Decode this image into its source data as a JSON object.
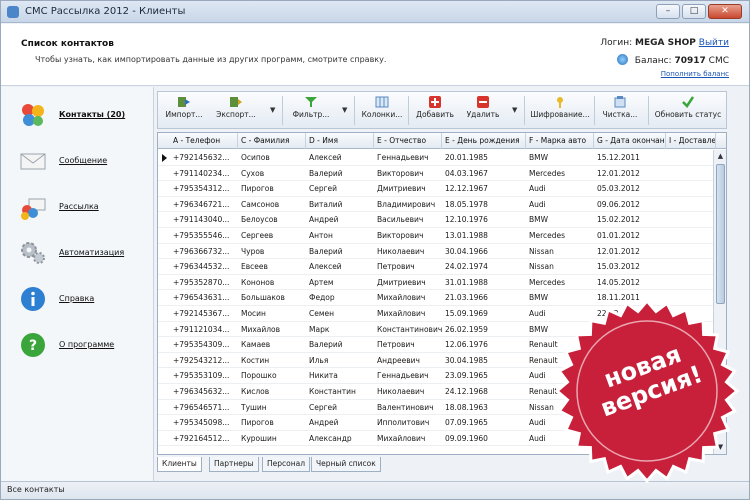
{
  "window": {
    "title": "СМС Рассылка 2012 - Клиенты"
  },
  "header": {
    "title": "Список контактов",
    "subtitle": "Чтобы узнать, как импортировать данные из других программ, смотрите справку.",
    "login_label": "Логин:",
    "login_value": "MEGA SHOP",
    "logout_link": "Выйти",
    "balance_label": "Баланс:",
    "balance_value": "70917",
    "balance_unit": "СМС",
    "topup_link": "Пополнить баланс"
  },
  "sidebar": {
    "items": [
      {
        "label": "Контакты (20)",
        "icon": "contacts-icon"
      },
      {
        "label": "Сообщение",
        "icon": "envelope-icon"
      },
      {
        "label": "Рассылка",
        "icon": "mailing-icon"
      },
      {
        "label": "Автоматизация",
        "icon": "gears-icon"
      },
      {
        "label": "Справка",
        "icon": "info-icon"
      },
      {
        "label": "О программе",
        "icon": "question-icon"
      }
    ]
  },
  "toolbar": {
    "import": "Импорт...",
    "export": "Экспорт...",
    "filter": "Фильтр...",
    "columns": "Колонки...",
    "add": "Добавить",
    "delete": "Удалить",
    "encrypt": "Шифрование...",
    "clean": "Чистка...",
    "refresh": "Обновить статус"
  },
  "grid": {
    "columns": [
      "A - Телефон",
      "C - Фамилия",
      "D - Имя",
      "E - Отчество",
      "E - День рождения",
      "F - Марка авто",
      "G - Дата окончан",
      "I - Доставле"
    ],
    "rows": [
      [
        "+792145632...",
        "Осипов",
        "Алексей",
        "Геннадьевич",
        "20.01.1985",
        "BMW",
        "15.12.2011"
      ],
      [
        "+791140234...",
        "Сухов",
        "Валерий",
        "Викторович",
        "04.03.1967",
        "Mercedes",
        "12.01.2012"
      ],
      [
        "+795354312...",
        "Пирогов",
        "Сергей",
        "Дмитриевич",
        "12.12.1967",
        "Audi",
        "05.03.2012"
      ],
      [
        "+796346721...",
        "Самсонов",
        "Виталий",
        "Владимирович",
        "18.05.1978",
        "Audi",
        "09.06.2012"
      ],
      [
        "+791143040...",
        "Белоусов",
        "Андрей",
        "Васильевич",
        "12.10.1976",
        "BMW",
        "15.02.2012"
      ],
      [
        "+795355546...",
        "Сергеев",
        "Антон",
        "Викторович",
        "13.01.1988",
        "Mercedes",
        "01.01.2012"
      ],
      [
        "+796366732...",
        "Чуров",
        "Валерий",
        "Николаевич",
        "30.04.1966",
        "Nissan",
        "12.01.2012"
      ],
      [
        "+796344532...",
        "Евсеев",
        "Алексей",
        "Петрович",
        "24.02.1974",
        "Nissan",
        "15.03.2012"
      ],
      [
        "+795352870...",
        "Кононов",
        "Артем",
        "Дмитриевич",
        "31.01.1988",
        "Mercedes",
        "14.05.2012"
      ],
      [
        "+796543631...",
        "Большаков",
        "Федор",
        "Михайлович",
        "21.03.1966",
        "BMW",
        "18.11.2011"
      ],
      [
        "+792145367...",
        "Мосин",
        "Семен",
        "Михайлович",
        "15.09.1969",
        "Audi",
        "22.02..."
      ],
      [
        "+791121034...",
        "Михайлов",
        "Марк",
        "Константинович",
        "26.02.1959",
        "BMW",
        ""
      ],
      [
        "+795354309...",
        "Камаев",
        "Валерий",
        "Петрович",
        "12.06.1976",
        "Renault",
        ""
      ],
      [
        "+792543212...",
        "Костин",
        "Илья",
        "Андреевич",
        "30.04.1985",
        "Renault",
        ""
      ],
      [
        "+795353109...",
        "Порошко",
        "Никита",
        "Геннадьевич",
        "23.09.1965",
        "Audi",
        ""
      ],
      [
        "+796345632...",
        "Кислов",
        "Константин",
        "Николаевич",
        "24.12.1968",
        "Renault",
        ""
      ],
      [
        "+796546571...",
        "Тушин",
        "Сергей",
        "Валентинович",
        "18.08.1963",
        "Nissan",
        ""
      ],
      [
        "+795345098...",
        "Пирогов",
        "Андрей",
        "Ипполитович",
        "07.09.1965",
        "Audi",
        ""
      ],
      [
        "+792164512...",
        "Курошин",
        "Александр",
        "Михайлович",
        "09.09.1960",
        "Audi",
        ""
      ]
    ]
  },
  "tabs": [
    "Клиенты",
    "Партнеры",
    "Персонал",
    "Черный список"
  ],
  "status": "Все контакты",
  "badge": {
    "text_line1": "новая",
    "text_line2": "версия!",
    "color": "#c8203a"
  },
  "colors": {
    "accent": "#1a55b5",
    "badge_red": "#c8203a"
  }
}
